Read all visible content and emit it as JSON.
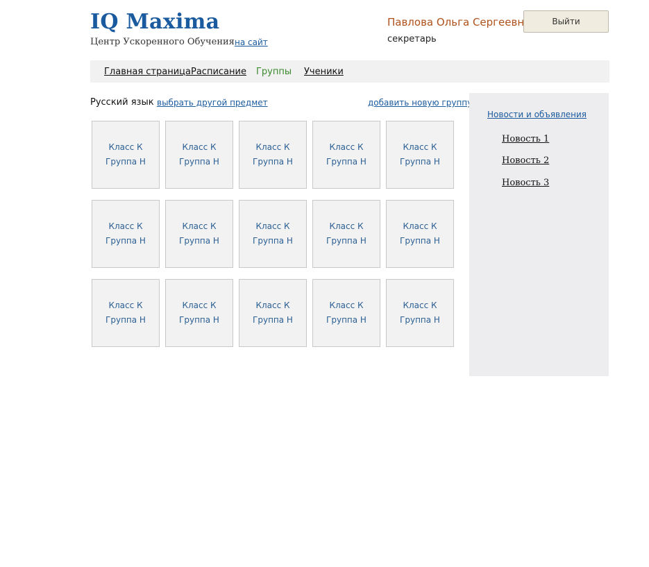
{
  "header": {
    "logo": "IQ Maxima",
    "subtitle": "Центр Ускоренного Обучения",
    "site_link": "на сайт",
    "user_name": "Павлова Ольга Сергеевна",
    "user_role": "секретарь",
    "logout_label": "Выйти"
  },
  "nav": {
    "items": [
      {
        "label": "Главная страница"
      },
      {
        "label": "Расписание"
      },
      {
        "label": "Группы"
      },
      {
        "label": "Ученики"
      }
    ],
    "active": "Группы"
  },
  "toolbar": {
    "subject": "Русский язык",
    "choose_subject": "выбрать другой предмет",
    "add_group": "добавить новую группу"
  },
  "groups": [
    {
      "cls": "Класс К",
      "group": "Группа Н"
    },
    {
      "cls": "Класс К",
      "group": "Группа Н"
    },
    {
      "cls": "Класс К",
      "group": "Группа Н"
    },
    {
      "cls": "Класс К",
      "group": "Группа Н"
    },
    {
      "cls": "Класс К",
      "group": "Группа Н"
    },
    {
      "cls": "Класс К",
      "group": "Группа Н"
    },
    {
      "cls": "Класс К",
      "group": "Группа Н"
    },
    {
      "cls": "Класс К",
      "group": "Группа Н"
    },
    {
      "cls": "Класс К",
      "group": "Группа Н"
    },
    {
      "cls": "Класс К",
      "group": "Группа Н"
    },
    {
      "cls": "Класс К",
      "group": "Группа Н"
    },
    {
      "cls": "Класс К",
      "group": "Группа Н"
    },
    {
      "cls": "Класс К",
      "group": "Группа Н"
    },
    {
      "cls": "Класс К",
      "group": "Группа Н"
    },
    {
      "cls": "Класс К",
      "group": "Группа Н"
    }
  ],
  "sidebar": {
    "title": "Новости и объявления",
    "news": [
      {
        "label": "Новость 1"
      },
      {
        "label": "Новость 2"
      },
      {
        "label": "Новость 3"
      }
    ]
  },
  "colors": {
    "brand": "#1a5a9e",
    "user_name": "#b0521c",
    "nav_active": "#3c8a2e",
    "card_bg": "#f2f2f2",
    "sidebar_bg": "#ededf0"
  }
}
